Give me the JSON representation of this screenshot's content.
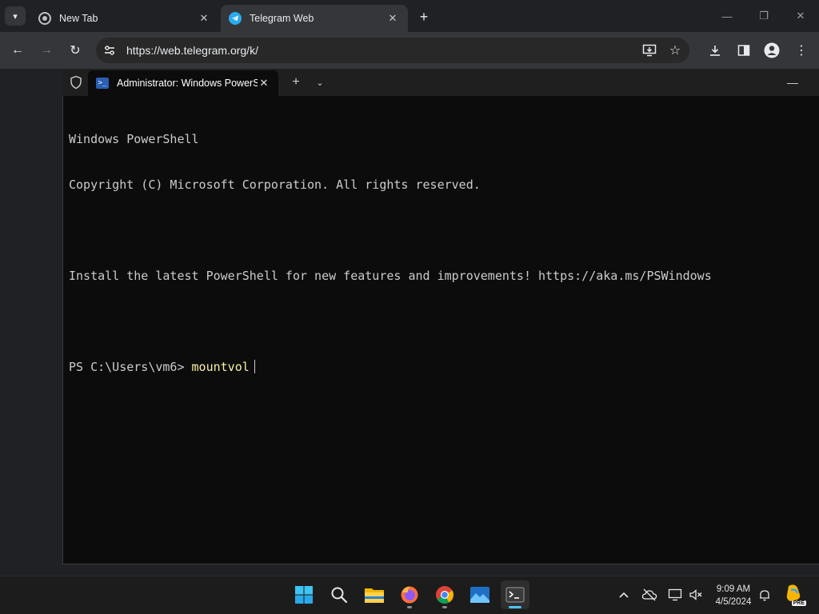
{
  "browser": {
    "tabs": [
      {
        "label": "New Tab",
        "favicon": "chrome-icon",
        "active": false
      },
      {
        "label": "Telegram Web",
        "favicon": "telegram-icon",
        "active": true
      }
    ],
    "url": "https://web.telegram.org/k/",
    "colors": {
      "tabstrip": "#202124",
      "toolbar": "#35363a",
      "telegram": "#2aabee"
    }
  },
  "terminal": {
    "tab_title": "Administrator: Windows PowerShell",
    "lines": [
      "Windows PowerShell",
      "Copyright (C) Microsoft Corporation. All rights reserved.",
      "",
      "Install the latest PowerShell for new features and improvements! https://aka.ms/PSWindows",
      ""
    ],
    "prompt": "PS C:\\Users\\vm6> ",
    "command": "mountvol",
    "colors": {
      "background": "#0c0c0c",
      "text": "#cccccc",
      "command": "#f9f1a5"
    }
  },
  "taskbar": {
    "apps": [
      "windows-start-icon",
      "search-icon",
      "file-explorer-icon",
      "firefox-icon",
      "chrome-icon",
      "photos-icon",
      "terminal-icon"
    ],
    "clock_time": "9:09 AM",
    "clock_date": "4/5/2024",
    "badge": "PRE"
  }
}
